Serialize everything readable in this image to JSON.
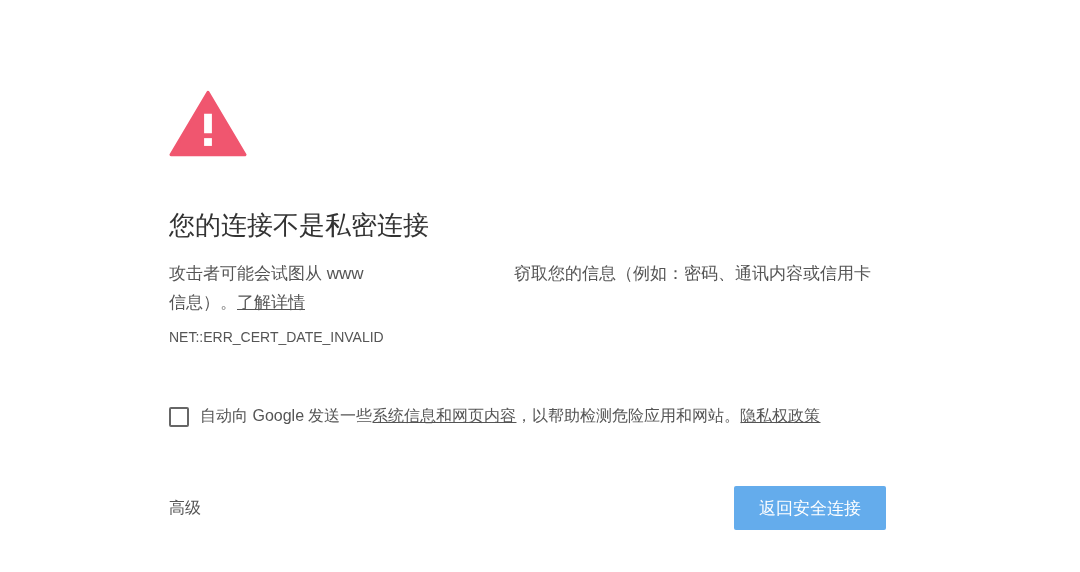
{
  "heading": "您的连接不是私密连接",
  "message": {
    "before": "攻击者可能会试图从 www",
    "after": "窃取您的信息（例如：密码、通讯内容或信用卡信息）。",
    "link": "了解详情"
  },
  "error_code": "NET::ERR_CERT_DATE_INVALID",
  "report": {
    "checked": false,
    "before": "自动向 Google 发送一些",
    "link": "系统信息和网页内容",
    "middle": "，以帮助检测危险应用和网站。",
    "privacy_link": "隐私权政策"
  },
  "advanced_button": "高级",
  "back_button": "返回安全连接"
}
